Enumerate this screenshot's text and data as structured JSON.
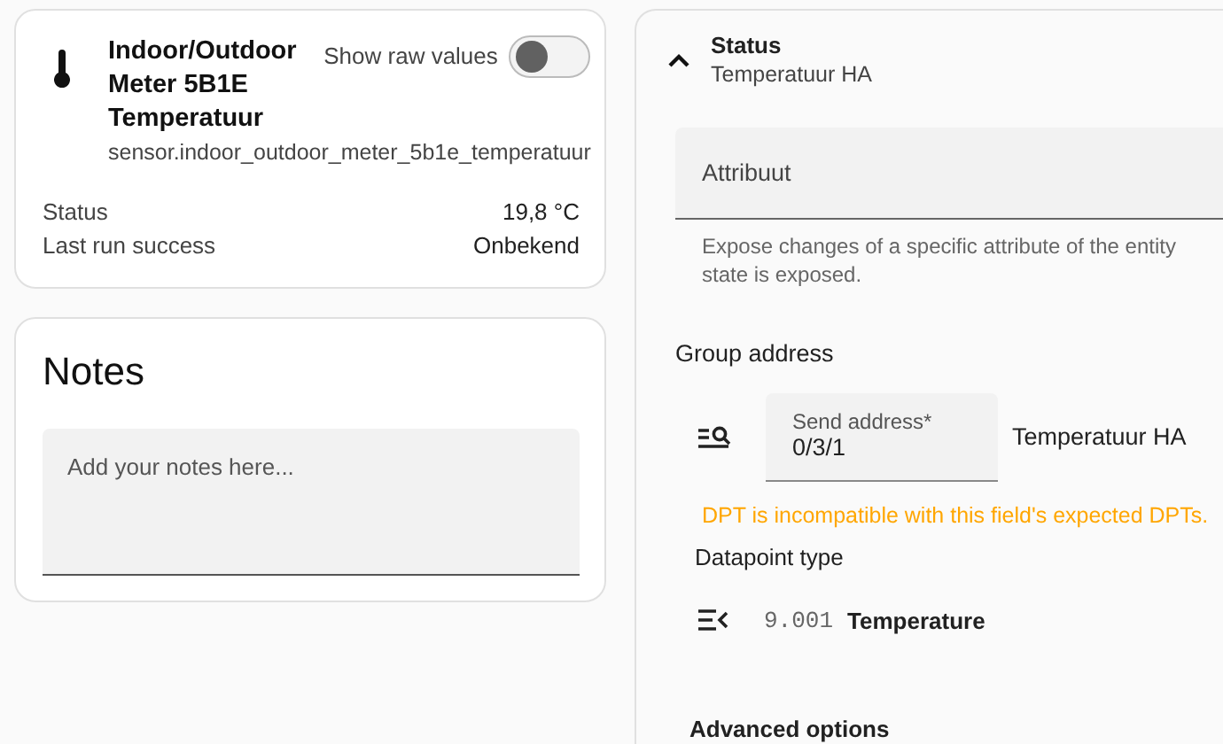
{
  "entity_card": {
    "name_lines": [
      "Indoor/Outdoor",
      "Meter 5B1E",
      "Temperatuur"
    ],
    "entity_id": "sensor.indoor_outdoor_meter_5b1e_temperatuur",
    "raw_toggle": {
      "label": "Show raw values",
      "on": false
    },
    "rows": [
      {
        "label": "Status",
        "value": "19,8 °C"
      },
      {
        "label": "Last run success",
        "value": "Onbekend"
      }
    ]
  },
  "notes": {
    "title": "Notes",
    "placeholder": "Add your notes here..."
  },
  "panel": {
    "title": "Status",
    "subtitle": "Temperatuur HA",
    "expanded": true,
    "attribute_field": {
      "placeholder": "Attribuut"
    },
    "helper_lines": [
      "Expose changes of a specific attribute of the entity",
      "state is exposed."
    ],
    "group_address_label": "Group address",
    "send_address": {
      "label": "Send address*",
      "value": "0/3/1",
      "name": "Temperatuur HA"
    },
    "warning": "DPT is incompatible with this field's expected DPTs.",
    "dpt_label": "Datapoint type",
    "dpt": {
      "code": "9.001",
      "name": "Temperature"
    },
    "advanced": "Advanced options"
  }
}
